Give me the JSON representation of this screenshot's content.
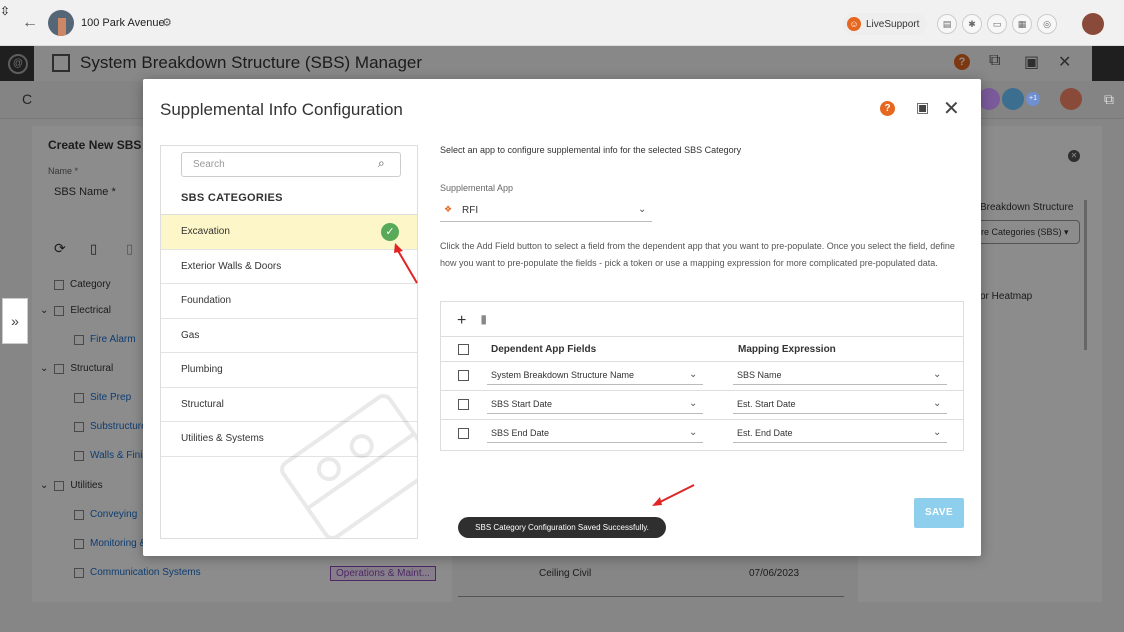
{
  "topbar": {
    "project": "100 Park Avenue",
    "live_support": "LiveSupport"
  },
  "manager": {
    "title": "System Breakdown Structure (SBS) Manager"
  },
  "background": {
    "create_title": "Create New SBS",
    "name_label": "Name *",
    "sbs_name_placeholder": "SBS Name *",
    "column_category": "Category",
    "rows": [
      {
        "label": "Electrical",
        "group": true
      },
      {
        "label": "Fire Alarm",
        "group": false
      },
      {
        "label": "Structural",
        "group": true
      },
      {
        "label": "Site Prep",
        "group": false
      },
      {
        "label": "Substructure",
        "group": false
      },
      {
        "label": "Walls & Finis",
        "group": false
      },
      {
        "label": "Utilities",
        "group": true
      },
      {
        "label": "Conveying",
        "group": false
      },
      {
        "label": "Monitoring &",
        "group": false
      },
      {
        "label": "Communication Systems",
        "group": false
      }
    ],
    "tag": "Operations & Maint...",
    "cell_text": "Ceiling Civil",
    "cell_date": "07/06/2023",
    "right_breakdown": "Breakdown Structure",
    "right_select": "re Categories (SBS)",
    "right_heatmap": "or Heatmap"
  },
  "modal": {
    "title": "Supplemental Info Configuration",
    "search_placeholder": "Search",
    "categories_header": "SBS CATEGORIES",
    "categories": [
      {
        "label": "Excavation",
        "selected": true
      },
      {
        "label": "Exterior Walls & Doors",
        "selected": false
      },
      {
        "label": "Foundation",
        "selected": false
      },
      {
        "label": "Gas",
        "selected": false
      },
      {
        "label": "Plumbing",
        "selected": false
      },
      {
        "label": "Structural",
        "selected": false
      },
      {
        "label": "Utilities & Systems",
        "selected": false
      }
    ],
    "intro": "Select an app to configure supplemental info for the selected SBS Category",
    "supplemental_app_label": "Supplemental App",
    "supplemental_app_value": "RFI",
    "description": "Click the Add Field button to select a field from the dependent app that you want to pre-populate. Once you select the field, define how you want to pre-populate the fields - pick a token or use a mapping expression for more complicated pre-populated data.",
    "grid": {
      "col_dependent": "Dependent App Fields",
      "col_mapping": "Mapping Expression",
      "rows": [
        {
          "field": "System Breakdown Structure Name",
          "mapping": "SBS Name"
        },
        {
          "field": "SBS Start Date",
          "mapping": "Est. Start Date"
        },
        {
          "field": "SBS End Date",
          "mapping": "Est. End Date"
        }
      ]
    },
    "save_label": "SAVE",
    "toast": "SBS Category Configuration Saved Successfully."
  },
  "colors": {
    "accent_orange": "#e6671f",
    "selected_row": "#fdf6c8",
    "check_green": "#58a958",
    "save_button": "#8fcfee",
    "arrow_red": "#e02424"
  }
}
